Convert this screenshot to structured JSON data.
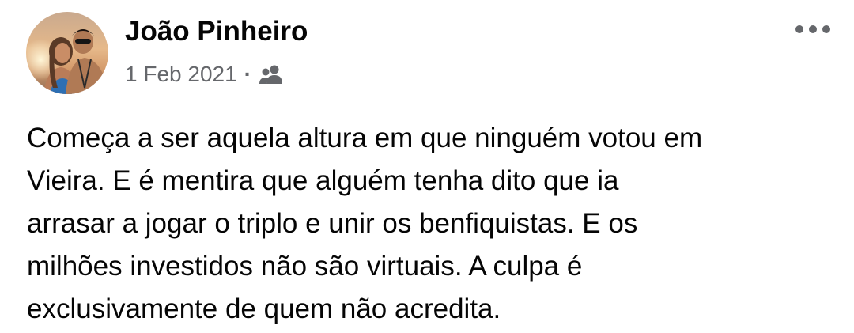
{
  "post": {
    "author": "João Pinheiro",
    "date": "1 Feb 2021",
    "separator": "·",
    "audience_icon": "friends-icon",
    "more_icon": "more-options-icon",
    "text": "Começa a ser aquela altura em que ninguém votou em\nVieira. E é mentira que alguém tenha dito que ia\narrasar a jogar o triplo e unir os benfiquistas. E os\nmilhões investidos não são virtuais. A culpa é\nexclusivamente de quem não acredita."
  },
  "colors": {
    "text_primary": "#050505",
    "text_secondary": "#65676b",
    "background": "#ffffff"
  }
}
